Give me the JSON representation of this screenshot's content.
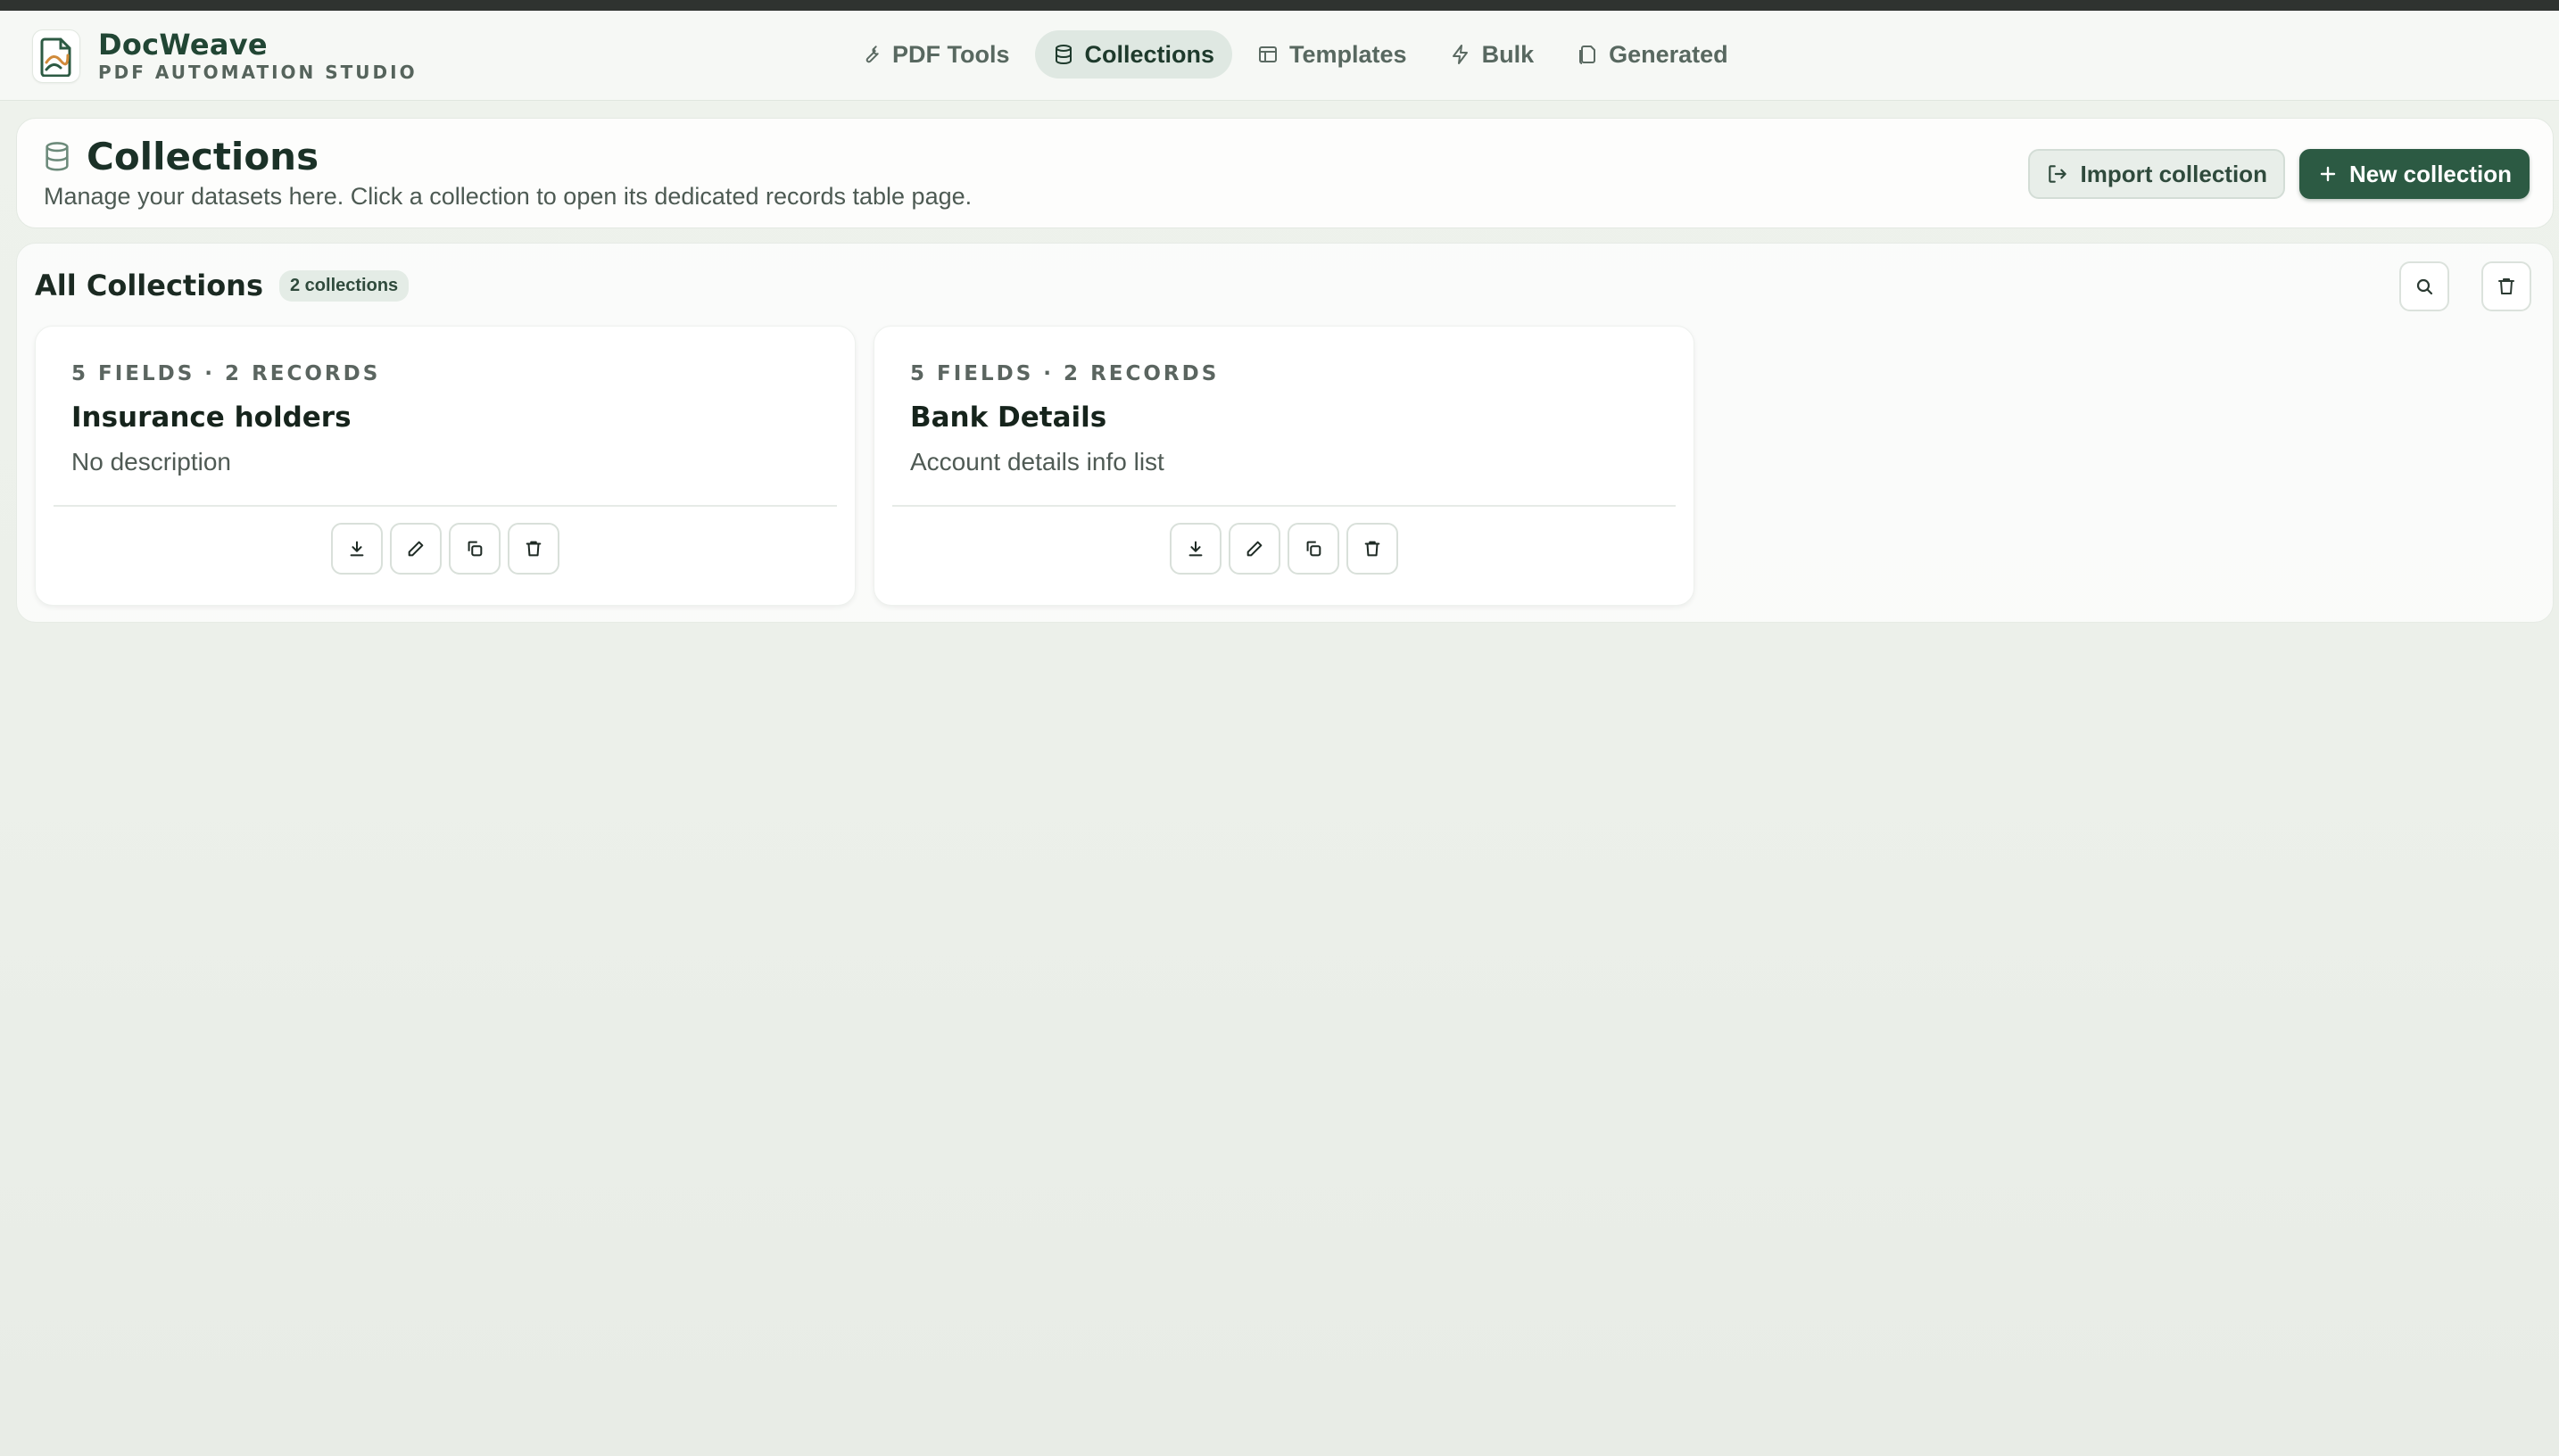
{
  "app": {
    "name": "DocWeave",
    "tagline": "PDF AUTOMATION STUDIO"
  },
  "nav": {
    "items": [
      {
        "label": "PDF Tools",
        "icon": "wrench-icon",
        "active": false
      },
      {
        "label": "Collections",
        "icon": "database-icon",
        "active": true
      },
      {
        "label": "Templates",
        "icon": "layout-icon",
        "active": false
      },
      {
        "label": "Bulk",
        "icon": "bolt-icon",
        "active": false
      },
      {
        "label": "Generated",
        "icon": "files-icon",
        "active": false
      }
    ]
  },
  "page": {
    "title": "Collections",
    "description": "Manage your datasets here. Click a collection to open its dedicated records table page.",
    "import_label": "Import collection",
    "new_label": "New collection"
  },
  "panel": {
    "title": "All Collections",
    "count": "2 collections"
  },
  "collections": [
    {
      "meta": "5 FIELDS · 2 RECORDS",
      "name": "Insurance holders",
      "description": "No description"
    },
    {
      "meta": "5 FIELDS · 2 RECORDS",
      "name": "Bank Details",
      "description": "Account details info list"
    }
  ],
  "colors": {
    "brand": "#2c5a43",
    "active_nav_bg": "#dfe8e2",
    "background": "#eef2ec"
  }
}
